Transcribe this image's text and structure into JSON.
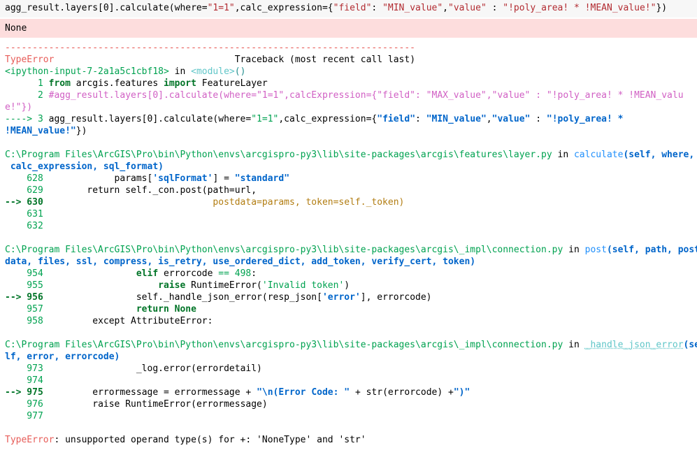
{
  "input_line": {
    "pre": "agg_result.layers[0].calculate(where=",
    "str1": "\"1=1\"",
    "mid": ",calc_expression={",
    "k1": "\"field\"",
    "c1": ": ",
    "v1": "\"MIN_value\"",
    "c2": ",",
    "k2": "\"value\"",
    "c3": " : ",
    "v2": "\"!poly_area! * !MEAN_value!\"",
    "end": "})"
  },
  "stderr": {
    "text": "None"
  },
  "traceback": {
    "sep": "---------------------------------------------------------------------------",
    "err_name": "TypeError",
    "header_pad": "                                 ",
    "header": "Traceback (most recent call last)",
    "f1": {
      "loc": "<ipython-input-7-2a1a5c1cbf18>",
      "in": " in ",
      "func": "<module>",
      "paren": "()",
      "l1_num": "      1 ",
      "l1_from": "from",
      "l1_mid": " arcgis.features ",
      "l1_import": "import",
      "l1_name": " FeatureLayer",
      "l2_num": "      2 ",
      "l2_comment_a": "#agg_result.layers[0].calculate(where=\"1=1\",calcExpression={\"field\": \"MAX_value\",\"value\" : \"!poly_area! * !MEAN_valu",
      "l2_comment_b": "e!\"})",
      "l3_arrow": "----> 3 ",
      "l3_pre": "agg_result.layers[0].calculate(where=",
      "l3_str1": "\"1=1\"",
      "l3_mid": ",calc_expression={",
      "l3_k1": "\"field\"",
      "l3_c1": ": ",
      "l3_v1": "\"MIN_value\"",
      "l3_c2": ",",
      "l3_k2": "\"value\"",
      "l3_c3": " : ",
      "l3_v2a": "\"!poly_area! *",
      "l3_v2b": "!MEAN_value!\"",
      "l3_end": "})"
    },
    "f2": {
      "path": "C:\\Program Files\\ArcGIS\\Pro\\bin\\Python\\envs\\arcgispro-py3\\lib\\site-packages\\arcgis\\features\\layer.py",
      "in": " in ",
      "func": "calculate",
      "args_a": "(self, where,",
      "args_b": " calc_expression, sql_format)",
      "r628_num": "    628",
      "r628_pre": "             params[",
      "r628_str": "'sqlFormat'",
      "r628_mid": "] = ",
      "r628_val": "\"standard\"",
      "r629_num": "    629",
      "r629_kw": "return",
      "r629_rest": " self._con.post(path=url,",
      "r630_arrow": "--> 630",
      "r630_code": "                               postdata=params, token=self._token)",
      "r631_num": "    631",
      "r632_num": "    632"
    },
    "f3": {
      "path": "C:\\Program Files\\ArcGIS\\Pro\\bin\\Python\\envs\\arcgispro-py3\\lib\\site-packages\\arcgis\\_impl\\connection.py",
      "in": " in ",
      "func": "post",
      "args_a": "(self, path, post",
      "args_b": "data, files, ssl, compress, is_retry, use_ordered_dict, add_token, verify_cert, token)",
      "r954_num": "    954",
      "r954_kw": "elif",
      "r954_mid": " errorcode ",
      "r954_op": "==",
      "r954_num_val": " 498",
      "r954_colon": ":",
      "r955_num": "    955",
      "r955_kw": "raise",
      "r955_mid": " RuntimeError(",
      "r955_str": "'Invalid token'",
      "r955_end": ")",
      "r956_arrow": "--> 956",
      "r956_pre": "                 self._handle_json_error(resp_json[",
      "r956_str": "'error'",
      "r956_end": "], errorcode)",
      "r957_num": "    957",
      "r957_kw": "return",
      "r957_val": " None",
      "r958_num": "    958",
      "r958_kw": "except",
      "r958_rest": " AttributeError:"
    },
    "f4": {
      "path": "C:\\Program Files\\ArcGIS\\Pro\\bin\\Python\\envs\\arcgispro-py3\\lib\\site-packages\\arcgis\\_impl\\connection.py",
      "in": " in ",
      "func": "_handle_json_error",
      "args_a": "(se",
      "args_b": "lf, error, errorcode)",
      "r973_num": "    973",
      "r973_code": "_log.error(errordetail)",
      "r974_num": "    974",
      "r975_arrow": "--> 975",
      "r975_pre": "errormessage = errormessage + ",
      "r975_str": "\"\\n(Error Code: \"",
      "r975_mid": " + str(errorcode) +",
      "r975_str2": "\")\"",
      "r976_num": "    976",
      "r976_kw": "raise",
      "r976_rest": " RuntimeError(errormessage)",
      "r977_num": "    977"
    },
    "final_name": "TypeError",
    "final_msg": ": unsupported operand type(s) for +: 'NoneType' and 'str'"
  },
  "colors": {
    "input_bg": "#f7f7f7",
    "stderr_bg": "#fddddd",
    "error_red": "#e75c58",
    "green": "#00a250",
    "blue": "#208ffb",
    "yellow": "#b27d12",
    "cyan": "#60c6c8"
  }
}
